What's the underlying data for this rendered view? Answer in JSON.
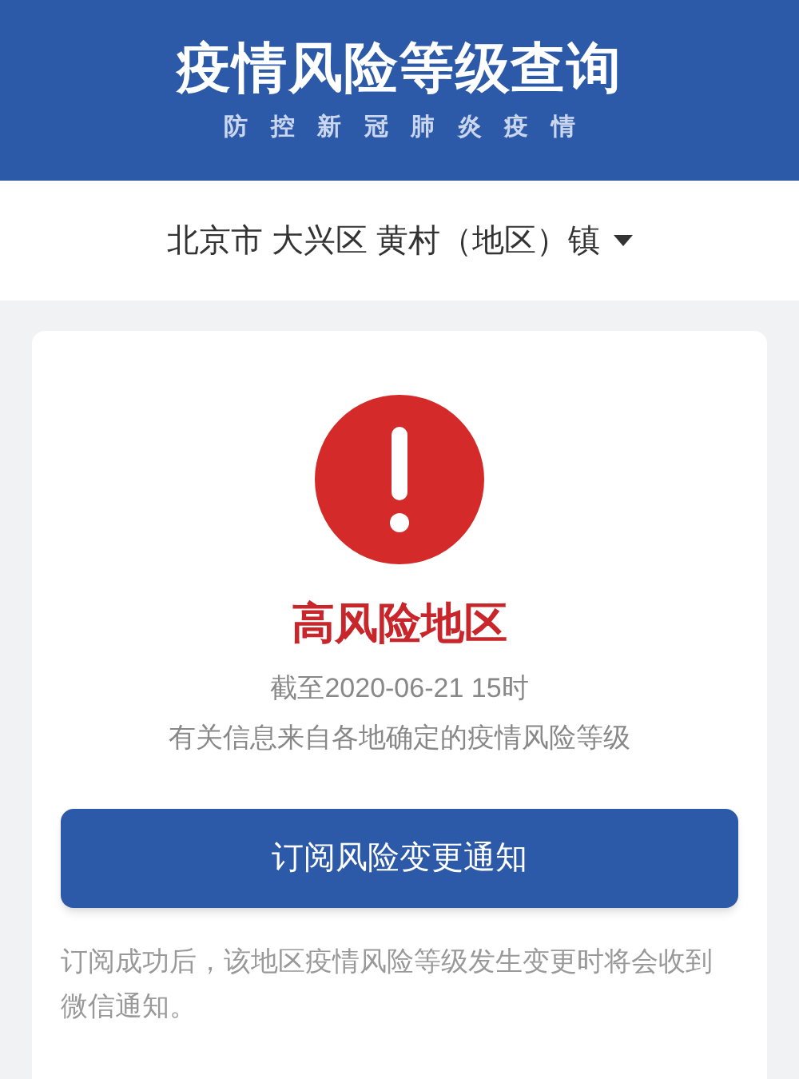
{
  "header": {
    "title": "疫情风险等级查询",
    "subtitle": "防控新冠肺炎疫情"
  },
  "location": {
    "value": "北京市 大兴区 黄村（地区）镇"
  },
  "result": {
    "level": "高风险地区",
    "updated": "截至2020-06-21 15时",
    "source": "有关信息来自各地确定的疫情风险等级"
  },
  "subscribe_button": "订阅风险变更通知",
  "note": "订阅成功后，该地区疫情风险等级发生变更时将会收到微信通知。"
}
